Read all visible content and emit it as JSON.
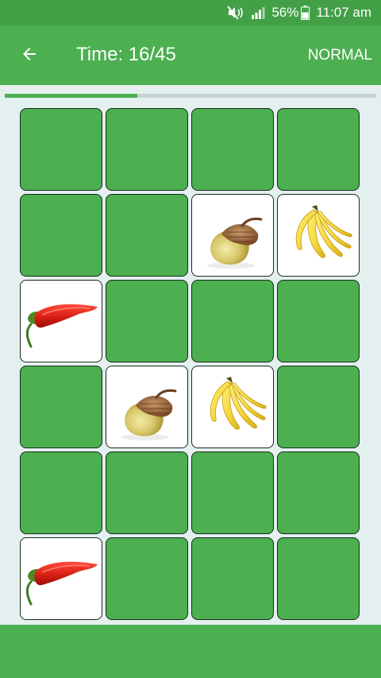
{
  "status_bar": {
    "battery_percent": "56%",
    "time": "11:07 am",
    "icons": [
      "mute-vibrate-icon",
      "signal-icon",
      "battery-icon"
    ]
  },
  "header": {
    "back_icon": "arrow-left-icon",
    "title": "Time: 16/45",
    "mode": "NORMAL"
  },
  "progress": {
    "value": 0.356
  },
  "colors": {
    "accent": "#4caf50",
    "status_bar": "#43a047",
    "background": "#e3f0ef",
    "card_back": "#4caf50",
    "card_face": "#ffffff"
  },
  "board": {
    "columns": 4,
    "rows": 6,
    "cards": [
      {
        "state": "hidden"
      },
      {
        "state": "hidden"
      },
      {
        "state": "hidden"
      },
      {
        "state": "hidden"
      },
      {
        "state": "hidden"
      },
      {
        "state": "hidden"
      },
      {
        "state": "revealed",
        "item": "acorn"
      },
      {
        "state": "revealed",
        "item": "banana"
      },
      {
        "state": "revealed",
        "item": "chili-pepper"
      },
      {
        "state": "hidden"
      },
      {
        "state": "hidden"
      },
      {
        "state": "hidden"
      },
      {
        "state": "hidden"
      },
      {
        "state": "revealed",
        "item": "acorn"
      },
      {
        "state": "revealed",
        "item": "banana"
      },
      {
        "state": "hidden"
      },
      {
        "state": "hidden"
      },
      {
        "state": "hidden"
      },
      {
        "state": "hidden"
      },
      {
        "state": "hidden"
      },
      {
        "state": "revealed",
        "item": "chili-pepper"
      },
      {
        "state": "hidden"
      },
      {
        "state": "hidden"
      },
      {
        "state": "hidden"
      }
    ]
  }
}
